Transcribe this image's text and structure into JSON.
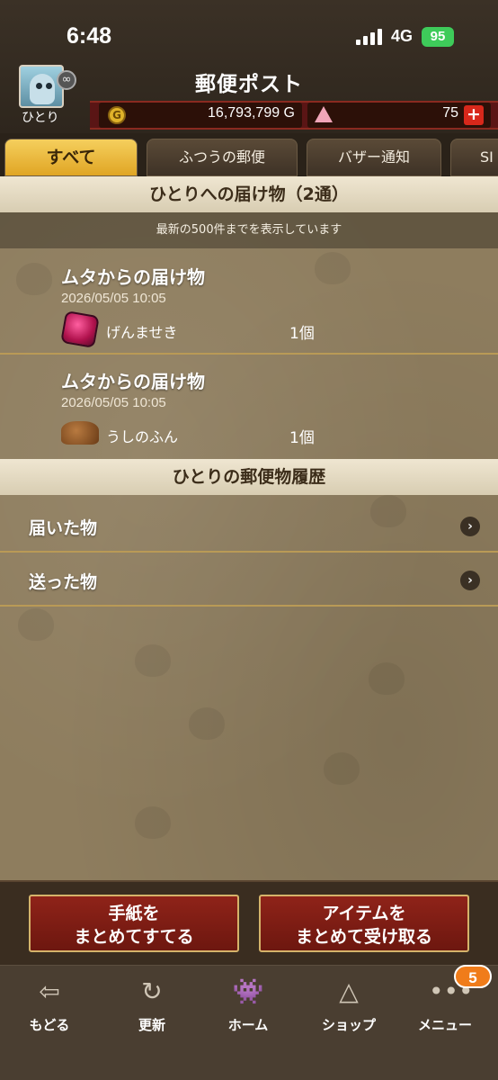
{
  "status_bar": {
    "time": "6:48",
    "network": "4G",
    "battery": "95"
  },
  "header": {
    "title": "郵便ポスト",
    "player_name": "ひとり",
    "gold_icon": "G",
    "gold": "16,793,799 G",
    "gems": "75",
    "plus": "+"
  },
  "tabs": [
    {
      "label": "すべて",
      "active": true
    },
    {
      "label": "ふつうの郵便",
      "active": false
    },
    {
      "label": "バザー通知",
      "active": false
    },
    {
      "label": "SI",
      "active": false
    }
  ],
  "deliveries": {
    "header": "ひとりへの届け物（2通）",
    "info": "最新の500件までを表示しています",
    "items": [
      {
        "title": "ムタからの届け物",
        "date": "2026/05/05  10:05",
        "item_name": "げんませき",
        "quantity": "1個",
        "icon": "gem-icon"
      },
      {
        "title": "ムタからの届け物",
        "date": "2026/05/05  10:05",
        "item_name": "うしのふん",
        "quantity": "1個",
        "icon": "dung-icon"
      }
    ]
  },
  "history": {
    "header": "ひとりの郵便物履歴",
    "items": [
      {
        "label": "届いた物"
      },
      {
        "label": "送った物"
      }
    ]
  },
  "actions": {
    "discard_line1": "手紙を",
    "discard_line2": "まとめてすてる",
    "receive_line1": "アイテムを",
    "receive_line2": "まとめて受け取る"
  },
  "bottom_nav": [
    {
      "label": "もどる",
      "icon": "back-arrow-icon"
    },
    {
      "label": "更新",
      "icon": "refresh-icon"
    },
    {
      "label": "ホーム",
      "icon": "home-monster-icon"
    },
    {
      "label": "ショップ",
      "icon": "slime-icon"
    },
    {
      "label": "メニュー",
      "icon": "menu-dots-icon"
    }
  ],
  "menu_badge": "5",
  "colors": {
    "tab_active": "#e8b53a",
    "action_button": "#7a1a12",
    "badge": "#f07c1a"
  }
}
